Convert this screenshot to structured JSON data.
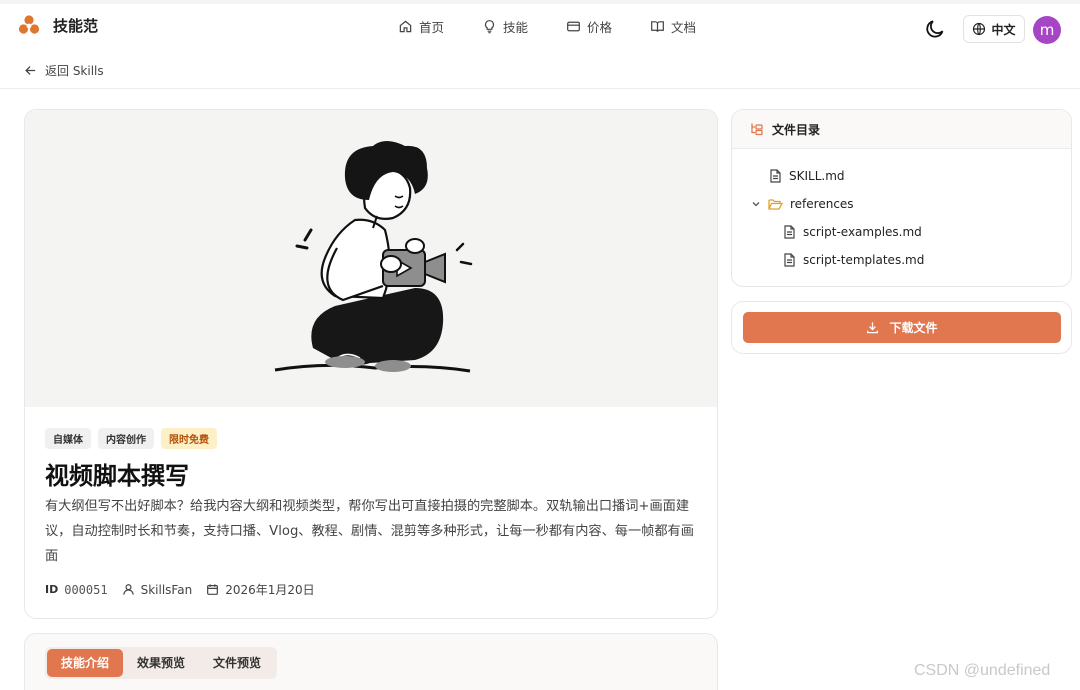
{
  "header": {
    "brand_name": "技能范",
    "nav": [
      {
        "label": "首页",
        "icon": "home-icon"
      },
      {
        "label": "技能",
        "icon": "lightbulb-icon"
      },
      {
        "label": "价格",
        "icon": "card-icon"
      },
      {
        "label": "文档",
        "icon": "book-icon"
      }
    ],
    "lang_label": "中文",
    "avatar_letter": "m"
  },
  "back": {
    "label": "返回 Skills"
  },
  "skill": {
    "tags": [
      "自媒体",
      "内容创作",
      "限时免费"
    ],
    "title": "视频脚本撰写",
    "description": "有大纲但写不出好脚本？给我内容大纲和视频类型，帮你写出可直接拍摄的完整脚本。双轨输出口播词+画面建议，自动控制时长和节奏，支持口播、Vlog、教程、剧情、混剪等多种形式，让每一秒都有内容、每一帧都有画面",
    "id_label": "ID",
    "id": "000051",
    "author": "SkillsFan",
    "date": "2026年1月20日"
  },
  "tabs": [
    {
      "label": "技能介绍",
      "active": true
    },
    {
      "label": "效果预览",
      "active": false
    },
    {
      "label": "文件预览",
      "active": false
    }
  ],
  "files": {
    "title": "文件目录",
    "items": [
      {
        "name": "SKILL.md",
        "type": "file"
      },
      {
        "name": "references",
        "type": "folder"
      },
      {
        "name": "script-examples.md",
        "type": "file"
      },
      {
        "name": "script-templates.md",
        "type": "file"
      }
    ],
    "download_label": "下载文件"
  },
  "watermark": "CSDN @undefined",
  "colors": {
    "accent": "#e0774f",
    "avatar": "#a646c7",
    "tag_free_bg": "#fdf0c6",
    "tag_free_text": "#b45309"
  }
}
